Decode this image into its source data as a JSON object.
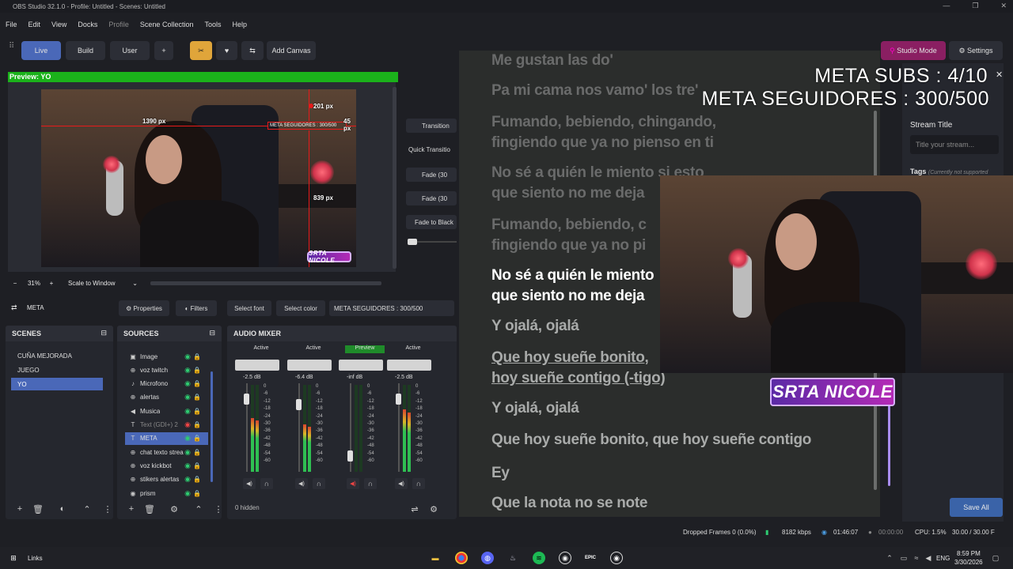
{
  "window": {
    "title": "OBS Studio 32.1.0 - Profile: Untitled - Scenes: Untitled"
  },
  "menu": [
    "File",
    "Edit",
    "View",
    "Docks",
    "Profile",
    "Scene Collection",
    "Tools",
    "Help"
  ],
  "toolbar": {
    "live": "Live",
    "build": "Build",
    "user": "User",
    "plus": "+",
    "add_canvas": "Add Canvas",
    "studio_mode": "Studio Mode",
    "settings": "Settings"
  },
  "preview": {
    "header": "Preview: YO",
    "guides": {
      "left": "1390 px",
      "top": "201 px",
      "right": "45 px",
      "bottom": "839 px"
    },
    "source_label": "META SEGUIDORES : 300/500",
    "logo": "SRTA NICOLE"
  },
  "transitions": {
    "title": "Transition",
    "quick": "Quick Transitio",
    "fade1": "Fade (30",
    "fade2": "Fade (30",
    "fade_black": "Fade to Black"
  },
  "zoom": {
    "minus": "−",
    "value": "31%",
    "plus": "+",
    "scale": "Scale to Window"
  },
  "props_bar": {
    "selected": "META",
    "properties": "Properties",
    "filters": "Filters",
    "font": "Select font",
    "color": "Select color",
    "text": "META SEGUIDORES : 300/500"
  },
  "scenes": {
    "title": "SCENES",
    "items": [
      "CUÑA MEJORADA",
      "JUEGO",
      "YO"
    ],
    "selected": 2
  },
  "sources": {
    "title": "SOURCES",
    "items": [
      {
        "label": "Image",
        "icon": "image-icon",
        "glyph": "▣",
        "visible": true
      },
      {
        "label": "voz twitch",
        "icon": "globe-icon",
        "glyph": "⊕",
        "visible": true
      },
      {
        "label": "Microfono",
        "icon": "mic-icon",
        "glyph": "♪",
        "visible": true
      },
      {
        "label": "alertas",
        "icon": "globe-icon",
        "glyph": "⊕",
        "visible": true
      },
      {
        "label": "Musica",
        "icon": "speaker-icon",
        "glyph": "◀",
        "visible": true
      },
      {
        "label": "Text (GDI+) 2",
        "icon": "text-icon",
        "glyph": "T",
        "visible": false
      },
      {
        "label": "META",
        "icon": "text-icon",
        "glyph": "T",
        "visible": true
      },
      {
        "label": "chat texto strea",
        "icon": "globe-icon",
        "glyph": "⊕",
        "visible": true
      },
      {
        "label": "voz kickbot",
        "icon": "globe-icon",
        "glyph": "⊕",
        "visible": true
      },
      {
        "label": "stikers alertas",
        "icon": "globe-icon",
        "glyph": "⊕",
        "visible": true
      },
      {
        "label": "prism",
        "icon": "camera-icon",
        "glyph": "◉",
        "visible": true
      }
    ],
    "selected": 6
  },
  "mixer": {
    "title": "AUDIO MIXER",
    "hidden": "0 hidden",
    "channels": [
      {
        "state": "Active",
        "db": "-2.5 dB",
        "level": 0.62,
        "fader": 0.87
      },
      {
        "state": "Active",
        "db": "-6.4 dB",
        "level": 0.55,
        "fader": 0.8
      },
      {
        "state": "Preview",
        "db": "-inf dB",
        "level": 0.0,
        "fader": 0.15
      },
      {
        "state": "Active",
        "db": "-2.5 dB",
        "level": 0.72,
        "fader": 0.87
      }
    ],
    "scale": [
      "0",
      "-6",
      "-12",
      "-18",
      "-24",
      "-30",
      "-36",
      "-42",
      "-48",
      "-54",
      "-60"
    ]
  },
  "lyrics": [
    {
      "text": "Me gustan las do'",
      "style": "past"
    },
    {
      "text": "Pa mi cama nos vamo' los tre'",
      "style": "past"
    },
    {
      "text": "Fumando, bebiendo, chingando,",
      "style": "past"
    },
    {
      "text": "fingiendo que ya no pienso en ti",
      "style": "past"
    },
    {
      "text": "No sé a quién le miento si esto",
      "style": "past"
    },
    {
      "text": "que siento no me deja",
      "style": "past"
    },
    {
      "text": "Fumando, bebiendo, c",
      "style": "past"
    },
    {
      "text": "fingiendo que ya no pi",
      "style": "past"
    },
    {
      "text": "No sé a quién le miento",
      "style": "cur"
    },
    {
      "text": "que siento no me deja",
      "style": "cur"
    },
    {
      "text": "Y ojalá, ojalá",
      "style": "next"
    },
    {
      "text": "Que hoy sueñe bonito,",
      "style": "next-u"
    },
    {
      "text": "hoy sueñe contigo (-tigo)",
      "style": "next-u"
    },
    {
      "text": "Y ojalá, ojalá",
      "style": "next"
    },
    {
      "text": "Que hoy sueñe bonito, que hoy sueñe contigo",
      "style": "next"
    },
    {
      "text": "Ey",
      "style": "next"
    },
    {
      "text": "Que la nota no se note",
      "style": "next"
    }
  ],
  "overlay": {
    "subs": "META SUBS : 4/10",
    "seguidores": "META SEGUIDORES : 300/500"
  },
  "stream_panel": {
    "title_label": "Stream Title",
    "title_placeholder": "Title your stream...",
    "tags": "Tags",
    "tags_note": "(Currently not supported",
    "save": "Save All"
  },
  "cam2_logo": "SRTA NICOLE",
  "status": {
    "dropped": "Dropped Frames 0 (0.0%)",
    "kbps": "8182 kbps",
    "live_time": "01:46:07",
    "rec_time": "00:00:00",
    "cpu": "CPU: 1.5%",
    "fps": "30.00 / 30.00 F"
  },
  "taskbar": {
    "links": "Links",
    "lang": "ENG",
    "time": "8:59 PM",
    "date": "3/30/2026"
  }
}
